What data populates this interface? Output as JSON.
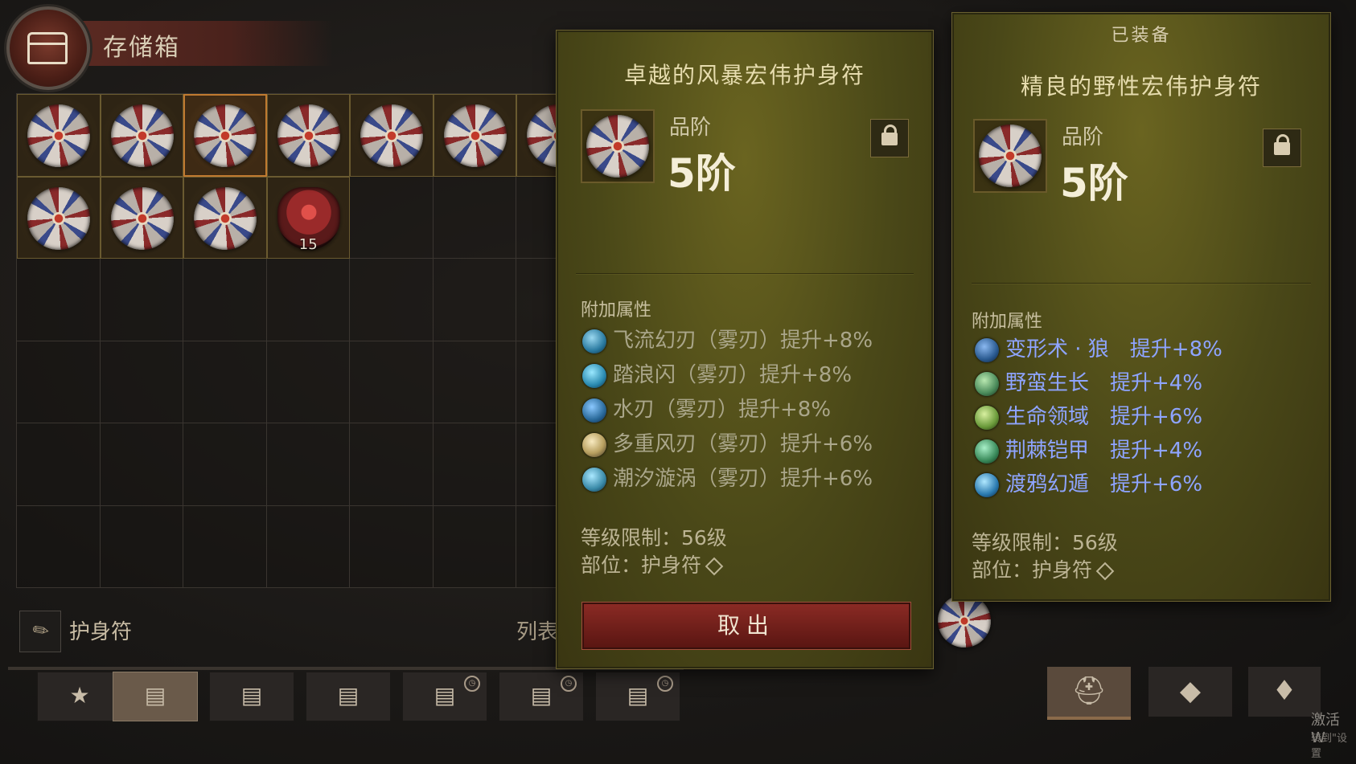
{
  "header": {
    "title": "存储箱",
    "emblem_icon": "chest-icon"
  },
  "storage": {
    "stack_count": "15",
    "filter_label": "护身符",
    "filter_icon": "feather-icon",
    "list_label": "列表"
  },
  "tabs": [
    {
      "icon": "star-icon",
      "glyph": "★"
    },
    {
      "icon": "chest-icon",
      "glyph": "▤"
    },
    {
      "icon": "chest-icon",
      "glyph": "▤"
    },
    {
      "icon": "chest-icon",
      "glyph": "▤"
    },
    {
      "icon": "chest-locked-icon",
      "glyph": "▤",
      "badge": "◷"
    },
    {
      "icon": "chest-locked-icon",
      "glyph": "▤",
      "badge": "◷"
    },
    {
      "icon": "chest-locked-icon",
      "glyph": "▤",
      "badge": "◷"
    }
  ],
  "right_tabs": [
    {
      "icon": "helmet-icon",
      "glyph": "⛑"
    },
    {
      "icon": "gem-icon",
      "glyph": "◆"
    },
    {
      "icon": "bag-icon",
      "glyph": "♦"
    }
  ],
  "watermark": {
    "line1": "激活 W",
    "line2": "转到\"设置"
  },
  "tooltip_hover": {
    "title": "卓越的风暴宏伟护身符",
    "grade_label": "品阶",
    "grade_value": "5阶",
    "affix_header": "附加属性",
    "affixes": [
      {
        "text": "飞流幻刃（雾刃）提升+8%",
        "color": "#2a7aa0"
      },
      {
        "text": "踏浪闪（雾刃）提升+8%",
        "color": "#2a8ab0"
      },
      {
        "text": "水刃（雾刃）提升+8%",
        "color": "#2a6a9a"
      },
      {
        "text": "多重风刃（雾刃）提升+6%",
        "color": "#b8a060"
      },
      {
        "text": "潮汐漩涡（雾刃）提升+6%",
        "color": "#3a8aa8"
      }
    ],
    "level_req": "等级限制：56级",
    "slot": "部位：护身符",
    "button_label": "取出"
  },
  "tooltip_equipped": {
    "equipped_label": "已装备",
    "title": "精良的野性宏伟护身符",
    "grade_label": "品阶",
    "grade_value": "5阶",
    "affix_header": "附加属性",
    "affixes": [
      {
        "text": "变形术 · 狼　提升+8%",
        "color": "#2a5a90"
      },
      {
        "text": "野蛮生长　提升+4%",
        "color": "#4a8a5a"
      },
      {
        "text": "生命领域　提升+6%",
        "color": "#6a9a3a"
      },
      {
        "text": "荆棘铠甲　提升+4%",
        "color": "#3a8a5a"
      },
      {
        "text": "渡鸦幻遁　提升+6%",
        "color": "#2a7ab0"
      }
    ],
    "level_req": "等级限制：56级",
    "slot": "部位：护身符"
  }
}
